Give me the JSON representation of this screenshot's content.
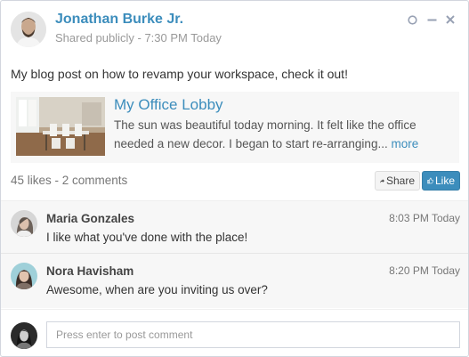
{
  "post": {
    "author_name": "Jonathan Burke Jr.",
    "meta": "Shared publicly - 7:30 PM Today",
    "text": "My blog post on how to revamp your workspace, check it out!",
    "attachment": {
      "title": "My Office Lobby",
      "description": "The sun was beautiful today morning. It felt like the office needed a new decor. I began to start re-arranging...",
      "more_label": "more"
    },
    "stats": "45 likes - 2 comments",
    "share_label": "Share",
    "like_label": "Like"
  },
  "comments": [
    {
      "name": "Maria Gonzales",
      "time": "8:03 PM Today",
      "text": "I like what you've done with the place!"
    },
    {
      "name": "Nora Havisham",
      "time": "8:20 PM Today",
      "text": "Awesome, when are you inviting us over?"
    }
  ],
  "footer": {
    "comment_placeholder": "Press enter to post comment"
  },
  "icons": {
    "header_tools": [
      "circle-icon",
      "minus-icon",
      "close-icon"
    ],
    "share": "share-arrow-icon",
    "like": "thumbs-up-icon"
  },
  "colors": {
    "accent": "#3c8dbc",
    "comments_bg": "#f7f7f7",
    "muted_text": "#999999"
  }
}
